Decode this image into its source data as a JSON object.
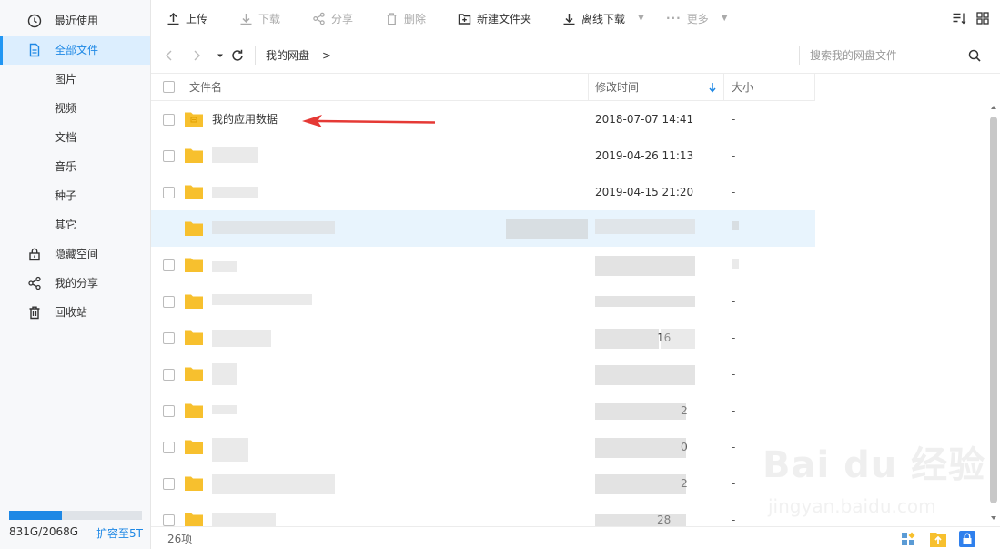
{
  "sidebar": {
    "items": [
      {
        "label": "最近使用",
        "icon": "clock-icon"
      },
      {
        "label": "全部文件",
        "icon": "document-icon",
        "active": true
      },
      {
        "label": "图片"
      },
      {
        "label": "视频"
      },
      {
        "label": "文档"
      },
      {
        "label": "音乐"
      },
      {
        "label": "种子"
      },
      {
        "label": "其它"
      },
      {
        "label": "隐藏空间",
        "icon": "lock-icon"
      },
      {
        "label": "我的分享",
        "icon": "share-icon"
      },
      {
        "label": "回收站",
        "icon": "trash-icon"
      }
    ],
    "quota": {
      "text": "831G/2068G",
      "used_fraction": 0.4,
      "expand_label": "扩容至5T"
    }
  },
  "toolbar": {
    "upload": "上传",
    "download": "下载",
    "share": "分享",
    "delete": "删除",
    "new_folder": "新建文件夹",
    "offline_download": "离线下载",
    "more": "更多"
  },
  "nav": {
    "breadcrumb_root": "我的网盘",
    "separator": ">",
    "search_placeholder": "搜索我的网盘文件"
  },
  "table": {
    "columns": {
      "name": "文件名",
      "modified": "修改时间",
      "size": "大小"
    },
    "rows": [
      {
        "name": "我的应用数据",
        "modified": "2018-07-07 14:41",
        "size": "-"
      },
      {
        "name": "",
        "modified": "2019-04-26 11:13",
        "size": "-"
      },
      {
        "name": "",
        "modified": "2019-04-15 21:20",
        "size": "-"
      },
      {
        "name": "",
        "modified": "",
        "size": "",
        "highlighted": true
      },
      {
        "name": "",
        "modified": "",
        "size": ""
      },
      {
        "name": "",
        "modified": "",
        "size": "-"
      },
      {
        "name": "",
        "modified": "16",
        "size": "-"
      },
      {
        "name": "",
        "modified": "",
        "size": "-"
      },
      {
        "name": "",
        "modified": "2",
        "size": "-"
      },
      {
        "name": "",
        "modified": "0",
        "size": "-"
      },
      {
        "name": "",
        "modified": "2",
        "size": "-"
      },
      {
        "name": "",
        "modified": "28",
        "size": "-"
      }
    ]
  },
  "footer": {
    "count": "26项"
  },
  "watermark": {
    "brand": "Bai du 经验",
    "url": "jingyan.baidu.com"
  },
  "colors": {
    "accent": "#1e88e5",
    "folder": "#f7c02e",
    "annotation": "#e53935"
  }
}
